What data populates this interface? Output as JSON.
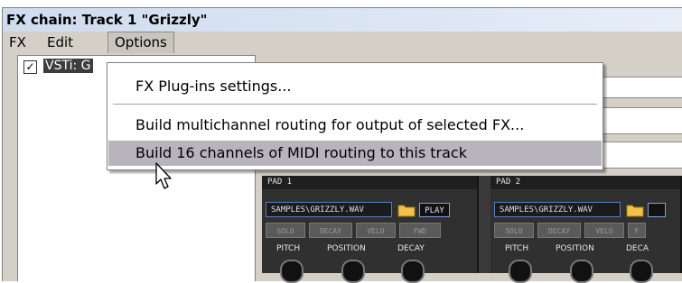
{
  "window": {
    "title": "FX chain: Track 1 \"Grizzly\""
  },
  "menubar": {
    "items": [
      {
        "label": "FX"
      },
      {
        "label": "Edit"
      },
      {
        "label": "Options"
      }
    ]
  },
  "fx_list": {
    "items": [
      {
        "label": "VSTi: G",
        "checked": true
      }
    ]
  },
  "options_menu": {
    "items": [
      {
        "label": "FX Plug-ins settings..."
      },
      {
        "label": "Build multichannel routing for output of selected FX..."
      },
      {
        "label": "Build 16 channels of MIDI routing to this track",
        "highlighted": true
      }
    ]
  },
  "plugin": {
    "pads": [
      {
        "header": "PAD 1",
        "sample": "SAMPLES\\GRIZZLY.WAV",
        "play_label": "PLAY",
        "buttons": [
          "SOLO",
          "DECAY",
          "VELO",
          "FWD"
        ],
        "knobs": [
          "PITCH",
          "POSITION",
          "DECAY"
        ]
      },
      {
        "header": "PAD 2",
        "sample": "SAMPLES\\GRIZZLY.WAV",
        "play_label": "",
        "buttons": [
          "SOLO",
          "DECAY",
          "VELO",
          "F"
        ],
        "knobs": [
          "PITCH",
          "POSITION",
          "DECA"
        ]
      }
    ]
  },
  "colors": {
    "menu_highlight": "#b8b4bd",
    "window_bg": "#d4d0c8",
    "sample_border": "#5a7cc0"
  }
}
